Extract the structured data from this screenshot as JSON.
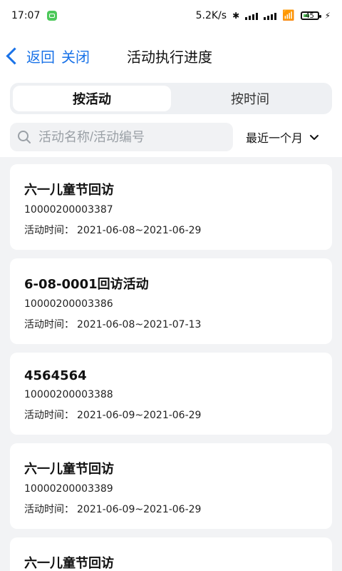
{
  "status": {
    "time": "17:07",
    "net_speed": "5.2K/s",
    "battery": "45",
    "battery_percent": 45
  },
  "header": {
    "back_label": "返回",
    "close_label": "关闭",
    "title": "活动执行进度"
  },
  "tabs": {
    "by_activity": "按活动",
    "by_time": "按时间"
  },
  "search": {
    "placeholder": "活动名称/活动编号",
    "value": ""
  },
  "filter": {
    "selected": "最近一个月"
  },
  "list": {
    "time_label": "活动时间：",
    "items": [
      {
        "title": "六一儿童节回访",
        "id": "10000200003387",
        "time": "2021-06-08~2021-06-29"
      },
      {
        "title": "6-08-0001回访活动",
        "id": "10000200003386",
        "time": "2021-06-08~2021-07-13"
      },
      {
        "title": "4564564",
        "id": "10000200003388",
        "time": "2021-06-09~2021-06-29"
      },
      {
        "title": "六一儿童节回访",
        "id": "10000200003389",
        "time": "2021-06-09~2021-06-29"
      },
      {
        "title": "六一儿童节回访",
        "id": "",
        "time": ""
      }
    ]
  },
  "colors": {
    "accent": "#1a73e8",
    "background": "#f2f3f5",
    "card": "#ffffff"
  }
}
